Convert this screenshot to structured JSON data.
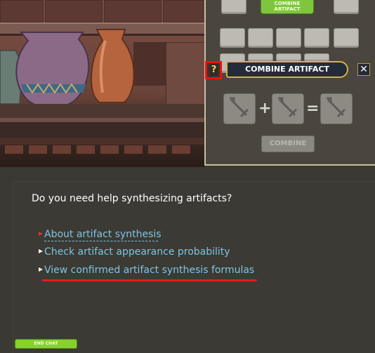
{
  "right_panel": {
    "combine_tab_label_line1": "COMBINE",
    "combine_tab_label_line2": "ARTIFACT"
  },
  "combine_window": {
    "help_label": "?",
    "title": "COMBINE ARTIFACT",
    "close_label": "✕",
    "plus_symbol": "+",
    "equals_symbol": "=",
    "combine_button_label": "COMBINE"
  },
  "dialog": {
    "question": "Do you need help synthesizing artifacts?",
    "options": [
      {
        "label": "About artifact synthesis",
        "bullet_color": "#e4312b"
      },
      {
        "label": "Check artifact appearance probability",
        "bullet_color": "#ffffff"
      },
      {
        "label": "View confirmed artifact synthesis formulas",
        "bullet_color": "#ffffff"
      }
    ],
    "end_chat_label": "END CHAT"
  },
  "colors": {
    "highlight_red": "#e41b1b",
    "option_text": "#7ec5e2",
    "accent_green": "#86d12e",
    "banner_gold": "#d6b24a"
  },
  "icons": {
    "artifact_slot": "sword-icon"
  }
}
